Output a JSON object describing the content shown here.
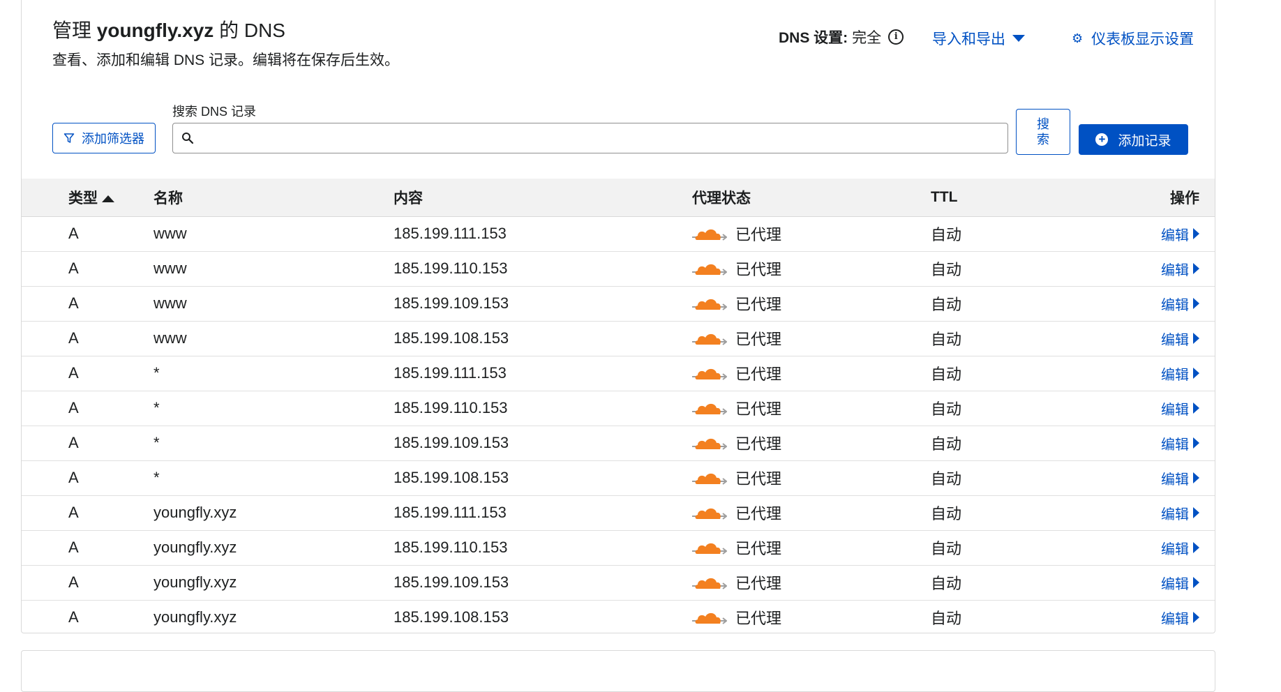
{
  "header": {
    "title_prefix": "管理 ",
    "domain": "youngfly.xyz",
    "title_suffix": " 的 DNS",
    "subtitle": "查看、添加和编辑 DNS 记录。编辑将在保存后生效。",
    "dns_setting_label": "DNS 设置:",
    "dns_setting_value": "完全",
    "import_export": "导入和导出",
    "dashboard_settings": "仪表板显示设置"
  },
  "toolbar": {
    "filter_button": "添加筛选器",
    "search_label": "搜索 DNS 记录",
    "search_value": "",
    "search_button": "搜索",
    "add_record_button": "添加记录"
  },
  "table": {
    "columns": {
      "type": "类型",
      "name": "名称",
      "content": "内容",
      "proxy": "代理状态",
      "ttl": "TTL",
      "action": "操作"
    },
    "rows": [
      {
        "type": "A",
        "name": "www",
        "content": "185.199.111.153",
        "proxy": "已代理",
        "ttl": "自动",
        "action": "编辑"
      },
      {
        "type": "A",
        "name": "www",
        "content": "185.199.110.153",
        "proxy": "已代理",
        "ttl": "自动",
        "action": "编辑"
      },
      {
        "type": "A",
        "name": "www",
        "content": "185.199.109.153",
        "proxy": "已代理",
        "ttl": "自动",
        "action": "编辑"
      },
      {
        "type": "A",
        "name": "www",
        "content": "185.199.108.153",
        "proxy": "已代理",
        "ttl": "自动",
        "action": "编辑"
      },
      {
        "type": "A",
        "name": "*",
        "content": "185.199.111.153",
        "proxy": "已代理",
        "ttl": "自动",
        "action": "编辑"
      },
      {
        "type": "A",
        "name": "*",
        "content": "185.199.110.153",
        "proxy": "已代理",
        "ttl": "自动",
        "action": "编辑"
      },
      {
        "type": "A",
        "name": "*",
        "content": "185.199.109.153",
        "proxy": "已代理",
        "ttl": "自动",
        "action": "编辑"
      },
      {
        "type": "A",
        "name": "*",
        "content": "185.199.108.153",
        "proxy": "已代理",
        "ttl": "自动",
        "action": "编辑"
      },
      {
        "type": "A",
        "name": "youngfly.xyz",
        "content": "185.199.111.153",
        "proxy": "已代理",
        "ttl": "自动",
        "action": "编辑"
      },
      {
        "type": "A",
        "name": "youngfly.xyz",
        "content": "185.199.110.153",
        "proxy": "已代理",
        "ttl": "自动",
        "action": "编辑"
      },
      {
        "type": "A",
        "name": "youngfly.xyz",
        "content": "185.199.109.153",
        "proxy": "已代理",
        "ttl": "自动",
        "action": "编辑"
      },
      {
        "type": "A",
        "name": "youngfly.xyz",
        "content": "185.199.108.153",
        "proxy": "已代理",
        "ttl": "自动",
        "action": "编辑"
      }
    ]
  },
  "icons": {
    "filter": "filter-icon",
    "search": "search-icon",
    "add": "plus-circle-icon",
    "info": "info-icon",
    "gear": "gear-icon",
    "proxied": "orange-cloud-icon",
    "sort": "sort-ascending-icon",
    "dropdown": "caret-down-icon",
    "expand": "caret-right-icon"
  },
  "colors": {
    "accent": "#0051c3",
    "cloud_orange": "#f38020",
    "header_bg": "#f2f2f2"
  }
}
